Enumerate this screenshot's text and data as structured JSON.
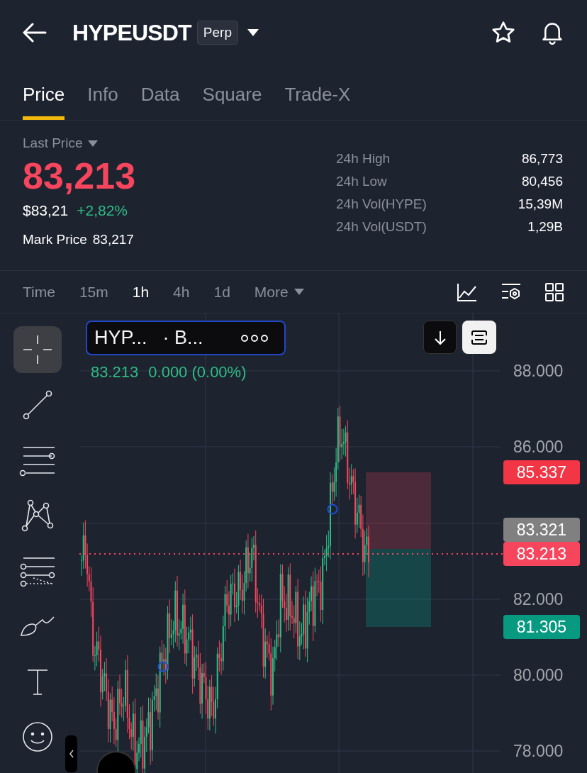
{
  "header": {
    "title": "HYPEUSDT",
    "badge": "Perp"
  },
  "tabs": [
    {
      "label": "Price",
      "selected": true
    },
    {
      "label": "Info",
      "selected": false
    },
    {
      "label": "Data",
      "selected": false
    },
    {
      "label": "Square",
      "selected": false
    },
    {
      "label": "Trade-X",
      "selected": false
    }
  ],
  "ticker": {
    "last_price_label": "Last Price",
    "last_price": "83,213",
    "usd_price": "$83,21",
    "change": "+2,82%",
    "mark_price_label": "Mark Price",
    "mark_price": "83,217"
  },
  "stats": [
    {
      "label": "24h High",
      "value": "86,773"
    },
    {
      "label": "24h Low",
      "value": "80,456"
    },
    {
      "label": "24h Vol(HYPE)",
      "value": "15,39M"
    },
    {
      "label": "24h Vol(USDT)",
      "value": "1,29B"
    }
  ],
  "intervals": [
    {
      "label": "Time",
      "selected": false
    },
    {
      "label": "15m",
      "selected": false
    },
    {
      "label": "1h",
      "selected": true
    },
    {
      "label": "4h",
      "selected": false
    },
    {
      "label": "1d",
      "selected": false
    }
  ],
  "more_label": "More",
  "drawing_tools": [
    {
      "kind": "crosshair",
      "selected": true
    },
    {
      "kind": "trend_line",
      "selected": false
    },
    {
      "kind": "parallel_lines",
      "selected": false
    },
    {
      "kind": "pattern",
      "selected": false
    },
    {
      "kind": "fib",
      "selected": false
    },
    {
      "kind": "brush",
      "selected": false
    },
    {
      "kind": "text",
      "selected": false
    },
    {
      "kind": "emoji",
      "selected": false
    }
  ],
  "chart": {
    "legend": {
      "symbol": "HYP...",
      "exchange": "· B...",
      "price": "83.213",
      "change": "0.000 (0.00%)"
    },
    "axis_labels": [
      "88.000",
      "86.000",
      "82.000",
      "80.000",
      "78.000"
    ],
    "price_tags": [
      {
        "value": "85.337",
        "color": "#f23645"
      },
      {
        "value": "83.321",
        "color": "#808080"
      },
      {
        "value": "83.213",
        "color": "#f6465d"
      },
      {
        "value": "81.305",
        "color": "#089981"
      }
    ]
  }
}
